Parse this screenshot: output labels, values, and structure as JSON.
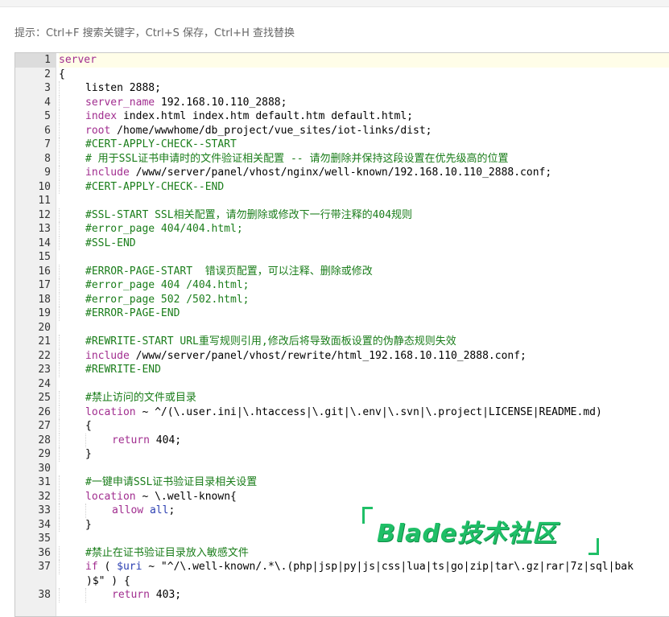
{
  "hint": "提示：Ctrl+F 搜索关键字，Ctrl+S 保存，Ctrl+H 查找替换",
  "watermark": "Blade技术社区",
  "colors": {
    "keyword": "#a12d8f",
    "comment": "#1a7d1a",
    "variable": "#2b3fb2",
    "string": "#1a1aa6",
    "watermark": "#1fbf67"
  },
  "editor": {
    "lines": [
      {
        "n": "1",
        "active": true,
        "indent": 0,
        "segments": [
          {
            "t": "server",
            "c": "kw"
          }
        ]
      },
      {
        "n": "2",
        "indent": 0,
        "segments": [
          {
            "t": "{",
            "c": "plain"
          }
        ]
      },
      {
        "n": "3",
        "indent": 1,
        "segments": [
          {
            "t": "listen 2888;",
            "c": "plain"
          }
        ]
      },
      {
        "n": "4",
        "indent": 1,
        "segments": [
          {
            "t": "server_name",
            "c": "kw"
          },
          {
            "t": " 192.168.10.110_2888;",
            "c": "plain"
          }
        ]
      },
      {
        "n": "5",
        "indent": 1,
        "segments": [
          {
            "t": "index",
            "c": "kw"
          },
          {
            "t": " index.html index.htm default.htm default.html;",
            "c": "plain"
          }
        ]
      },
      {
        "n": "6",
        "indent": 1,
        "segments": [
          {
            "t": "root",
            "c": "kw"
          },
          {
            "t": " /home/wwwhome/db_project/vue_sites/iot-links/dist;",
            "c": "plain"
          }
        ]
      },
      {
        "n": "7",
        "indent": 1,
        "segments": [
          {
            "t": "#CERT-APPLY-CHECK--START",
            "c": "cm"
          }
        ]
      },
      {
        "n": "8",
        "indent": 1,
        "segments": [
          {
            "t": "# 用于SSL证书申请时的文件验证相关配置 -- 请勿删除并保持这段设置在优先级高的位置",
            "c": "cm"
          }
        ]
      },
      {
        "n": "9",
        "indent": 1,
        "segments": [
          {
            "t": "include",
            "c": "kw"
          },
          {
            "t": " /www/server/panel/vhost/nginx/well-known/192.168.10.110_2888.conf;",
            "c": "plain"
          }
        ]
      },
      {
        "n": "10",
        "indent": 1,
        "segments": [
          {
            "t": "#CERT-APPLY-CHECK--END",
            "c": "cm"
          }
        ]
      },
      {
        "n": "11",
        "indent": 0,
        "segments": []
      },
      {
        "n": "12",
        "indent": 1,
        "segments": [
          {
            "t": "#SSL-START SSL相关配置，请勿删除或修改下一行带注释的404规则",
            "c": "cm"
          }
        ]
      },
      {
        "n": "13",
        "indent": 1,
        "segments": [
          {
            "t": "#error_page 404/404.html;",
            "c": "cm"
          }
        ]
      },
      {
        "n": "14",
        "indent": 1,
        "segments": [
          {
            "t": "#SSL-END",
            "c": "cm"
          }
        ]
      },
      {
        "n": "15",
        "indent": 0,
        "segments": []
      },
      {
        "n": "16",
        "indent": 1,
        "segments": [
          {
            "t": "#ERROR-PAGE-START  错误页配置，可以注释、删除或修改",
            "c": "cm"
          }
        ]
      },
      {
        "n": "17",
        "indent": 1,
        "segments": [
          {
            "t": "#error_page 404 /404.html;",
            "c": "cm"
          }
        ]
      },
      {
        "n": "18",
        "indent": 1,
        "segments": [
          {
            "t": "#error_page 502 /502.html;",
            "c": "cm"
          }
        ]
      },
      {
        "n": "19",
        "indent": 1,
        "segments": [
          {
            "t": "#ERROR-PAGE-END",
            "c": "cm"
          }
        ]
      },
      {
        "n": "20",
        "indent": 0,
        "segments": []
      },
      {
        "n": "21",
        "indent": 1,
        "segments": [
          {
            "t": "#REWRITE-START URL重写规则引用,修改后将导致面板设置的伪静态规则失效",
            "c": "cm"
          }
        ]
      },
      {
        "n": "22",
        "indent": 1,
        "segments": [
          {
            "t": "include",
            "c": "kw"
          },
          {
            "t": " /www/server/panel/vhost/rewrite/html_192.168.10.110_2888.conf;",
            "c": "plain"
          }
        ]
      },
      {
        "n": "23",
        "indent": 1,
        "segments": [
          {
            "t": "#REWRITE-END",
            "c": "cm"
          }
        ]
      },
      {
        "n": "24",
        "indent": 0,
        "segments": []
      },
      {
        "n": "25",
        "indent": 1,
        "segments": [
          {
            "t": "#禁止访问的文件或目录",
            "c": "cm"
          }
        ]
      },
      {
        "n": "26",
        "indent": 1,
        "segments": [
          {
            "t": "location",
            "c": "kw"
          },
          {
            "t": " ~ ^/(\\.user.ini|\\.htaccess|\\.git|\\.env|\\.svn|\\.project|LICENSE|README.md)",
            "c": "plain"
          }
        ]
      },
      {
        "n": "27",
        "indent": 1,
        "segments": [
          {
            "t": "{",
            "c": "plain"
          }
        ]
      },
      {
        "n": "28",
        "indent": 2,
        "segments": [
          {
            "t": "return",
            "c": "kw"
          },
          {
            "t": " 404;",
            "c": "plain"
          }
        ]
      },
      {
        "n": "29",
        "indent": 1,
        "segments": [
          {
            "t": "}",
            "c": "plain"
          }
        ]
      },
      {
        "n": "30",
        "indent": 0,
        "segments": []
      },
      {
        "n": "31",
        "indent": 1,
        "segments": [
          {
            "t": "#一键申请SSL证书验证目录相关设置",
            "c": "cm"
          }
        ]
      },
      {
        "n": "32",
        "indent": 1,
        "segments": [
          {
            "t": "location",
            "c": "kw"
          },
          {
            "t": " ~ \\.well-known{",
            "c": "plain"
          }
        ]
      },
      {
        "n": "33",
        "indent": 2,
        "segments": [
          {
            "t": "allow",
            "c": "kw"
          },
          {
            "t": " ",
            "c": "plain"
          },
          {
            "t": "all",
            "c": "var"
          },
          {
            "t": ";",
            "c": "plain"
          }
        ]
      },
      {
        "n": "34",
        "indent": 1,
        "segments": [
          {
            "t": "}",
            "c": "plain"
          }
        ]
      },
      {
        "n": "35",
        "indent": 0,
        "segments": []
      },
      {
        "n": "36",
        "indent": 1,
        "segments": [
          {
            "t": "#禁止在证书验证目录放入敏感文件",
            "c": "cm"
          }
        ]
      },
      {
        "n": "37",
        "indent": 1,
        "segments": [
          {
            "t": "if",
            "c": "kw"
          },
          {
            "t": " ( ",
            "c": "plain"
          },
          {
            "t": "$uri",
            "c": "var"
          },
          {
            "t": " ~ \"^/\\.well-known/.*\\.(php|jsp|py|js|css|lua|ts|go|zip|tar\\.gz|rar|7z|sql|bak",
            "c": "plain"
          }
        ]
      },
      {
        "n": "",
        "wrap": true,
        "indent": 0,
        "segments": [
          {
            "t": ")$\" ) {",
            "c": "plain"
          }
        ]
      },
      {
        "n": "38",
        "indent": 2,
        "segments": [
          {
            "t": "return",
            "c": "kw"
          },
          {
            "t": " 403;",
            "c": "plain"
          }
        ]
      }
    ]
  }
}
